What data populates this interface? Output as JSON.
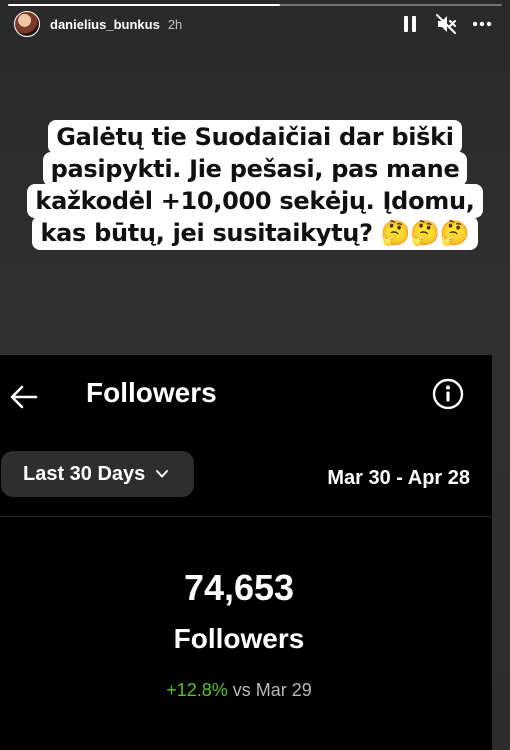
{
  "story": {
    "username": "danielius_bunkus",
    "time": "2h",
    "progress": 0.55,
    "icons": [
      "pause-icon",
      "muted-speaker-icon",
      "more-icon"
    ]
  },
  "caption": {
    "lines": [
      "Galėtų tie Suodaičiai dar biški",
      "pasipykti. Jie pešasi, pas mane",
      "kažkodėl +10,000 sekėjų. Įdomu,",
      "kas būtų, jei susitaikytų? 🤔🤔🤔"
    ]
  },
  "screenshot": {
    "title": "Followers",
    "range_label": "Last 30 Days",
    "date_range": "Mar 30 - Apr 28",
    "count": "74,653",
    "count_label": "Followers",
    "delta_value": "+12.8%",
    "delta_suffix": " vs Mar 29",
    "colors": {
      "positive": "#58c322",
      "background": "#000000"
    }
  }
}
